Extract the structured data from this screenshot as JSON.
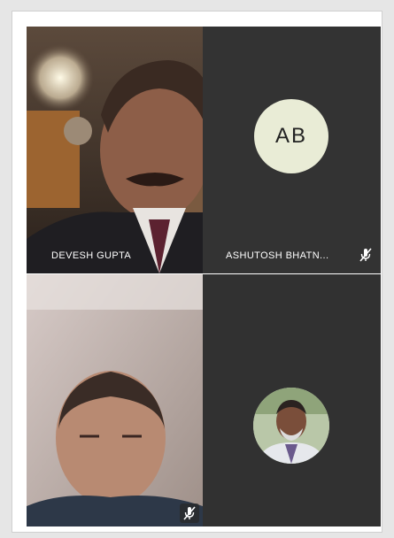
{
  "participants": [
    {
      "name": "DEVESH GUPTA",
      "video": "camera",
      "muted": false
    },
    {
      "name": "ASHUTOSH  BHATN...",
      "initials": "AB",
      "video": "off",
      "muted": true
    },
    {
      "name": "",
      "video": "camera",
      "muted": true
    },
    {
      "name": "",
      "video": "profile-photo",
      "muted": false
    }
  ],
  "colors": {
    "tile_dark": "#333333",
    "initials_bg": "#e9ecd6",
    "name_text": "#ffffff"
  }
}
